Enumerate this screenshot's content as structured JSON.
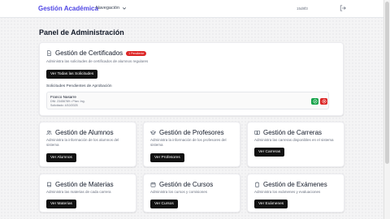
{
  "navbar": {
    "brand": "Gestión Académica",
    "menu_label": "Navegación",
    "user_label": "15d8f3",
    "logout_icon": "logout-icon"
  },
  "page_title": "Panel de Administración",
  "certificates": {
    "title": "Gestión de Certificados",
    "badge": "1 Pendiente",
    "description": "Administra las solicitudes de certificados de alumnos regulares",
    "button": "Ver Todas las Solicitudes",
    "pending_heading": "Solicitudes Pendientes de Aprobación",
    "request": {
      "name": "Franco Nasarre",
      "dni": "DNI: 23456789 • Plan: Ing.",
      "date": "Solicitado: 4/10/2025"
    }
  },
  "cards": [
    {
      "title": "Gestión de Alumnos",
      "description": "Administra la información de los alumnos del sistema",
      "button": "Ver Alumnos",
      "icon": "users-icon"
    },
    {
      "title": "Gestión de Profesores",
      "description": "Administra la información de los profesores del sistema",
      "button": "Ver Profesores",
      "icon": "graduation-cap-icon"
    },
    {
      "title": "Gestión de Carreras",
      "description": "Administra las carreras disponibles en el sistema",
      "button": "Ver Carreras",
      "icon": "book-open-icon"
    },
    {
      "title": "Gestión de Materias",
      "description": "Administra las materias de cada carrera",
      "button": "Ver Materias",
      "icon": "book-icon"
    },
    {
      "title": "Gestión de Cursos",
      "description": "Administra los cursos y comisiones",
      "button": "Ver Cursos",
      "icon": "calendar-icon"
    },
    {
      "title": "Gestión de Exámenes",
      "description": "Administra los exámenes y evaluaciones",
      "button": "Ver Exámenes",
      "icon": "clipboard-icon"
    }
  ],
  "colors": {
    "brand": "#4f46e5",
    "badge": "#dc2626",
    "approve": "#16a34a",
    "reject": "#dc2626",
    "button": "#111111"
  }
}
